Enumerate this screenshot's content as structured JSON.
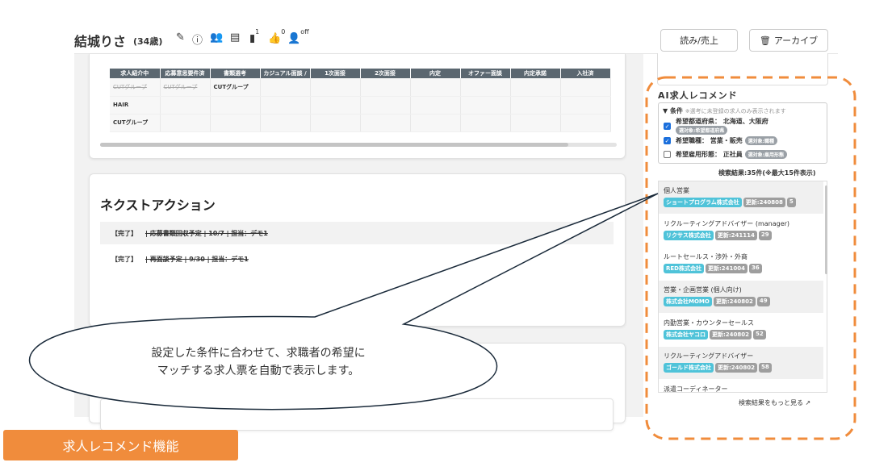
{
  "header": {
    "name": "結城りさ",
    "age": "(34歳)",
    "badge_docs": "1",
    "badge_like": "0",
    "badge_off": "off",
    "read_sales_button": "読み/売上",
    "archive_button": "アーカイブ"
  },
  "selection_table": {
    "columns": [
      "求人紹介中",
      "応募意思要件済",
      "書類選考",
      "カジュアル面談 /",
      "1次面接",
      "2次面接",
      "内定",
      "オファー面談",
      "内定承諾",
      "入社済"
    ],
    "rows": [
      [
        "CUTグループ",
        "CUTグループ",
        "CUTグループ",
        "",
        "",
        "",
        "",
        "",
        "",
        ""
      ],
      [
        "HAIR",
        "",
        "",
        "",
        "",
        "",
        "",
        "",
        "",
        ""
      ],
      [
        "CUTグループ",
        "",
        "",
        "",
        "",
        "",
        "",
        "",
        "",
        ""
      ]
    ]
  },
  "next_action": {
    "title": "ネクストアクション",
    "items": [
      {
        "status": "【完了】",
        "text": "| 応募書類回収予定 | 10/7 | 担当：デモ1"
      },
      {
        "status": "【完了】",
        "text": "| 再面談予定 | 9/30 | 担当：デモ1"
      }
    ]
  },
  "ai_recommend": {
    "title": "AI求人レコメンド",
    "conditions_label": "▼ 条件",
    "conditions_note": "※選考に未登録の求人のみ表示されます",
    "conditions": [
      {
        "label": "希望都道府県： 北海道、大阪府",
        "pill": "選対象:希望都道府県",
        "checked": true
      },
      {
        "label": "希望職種： 営業・販売",
        "pill": "選対象:職種",
        "checked": true
      },
      {
        "label": "希望雇用形態： 正社員",
        "pill": "選対象:雇用形態",
        "checked": false
      }
    ],
    "result_count": "検索結果:35件(※最大15件表示)",
    "jobs": [
      {
        "title": "個人営業",
        "company": "ショートプログラム株式会社",
        "updated": "更新:240808",
        "count": "5"
      },
      {
        "title": "リクルーティングアドバイザー (manager)",
        "company": "リクサス株式会社",
        "updated": "更新:241114",
        "count": "29"
      },
      {
        "title": "ルートセールス・渉外・外商",
        "company": "RED株式会社",
        "updated": "更新:241004",
        "count": "36"
      },
      {
        "title": "営業・企画営業 (個人向け)",
        "company": "株式会社MOMO",
        "updated": "更新:240802",
        "count": "49"
      },
      {
        "title": "内勤営業・カウンターセールス",
        "company": "株式会社ヤコロ",
        "updated": "更新:240802",
        "count": "52"
      },
      {
        "title": "リクルーティングアドバイザー",
        "company": "ゴールド株式会社",
        "updated": "更新:240802",
        "count": "58"
      },
      {
        "title": "派遣コーディネーター",
        "company": "",
        "updated": "",
        "count": ""
      }
    ],
    "more_link": "検索結果をもっと見る"
  },
  "callout": {
    "line1": "設定した条件に合わせて、求職者の希望に",
    "line2": "マッチする求人票を自動で表示します。"
  },
  "feature_label": "求人レコメンド機能",
  "colors": {
    "accent_orange": "#f08c3c",
    "company_tag": "#4fc3d9",
    "table_header": "#5b6770",
    "checkbox": "#1b6fdc"
  }
}
